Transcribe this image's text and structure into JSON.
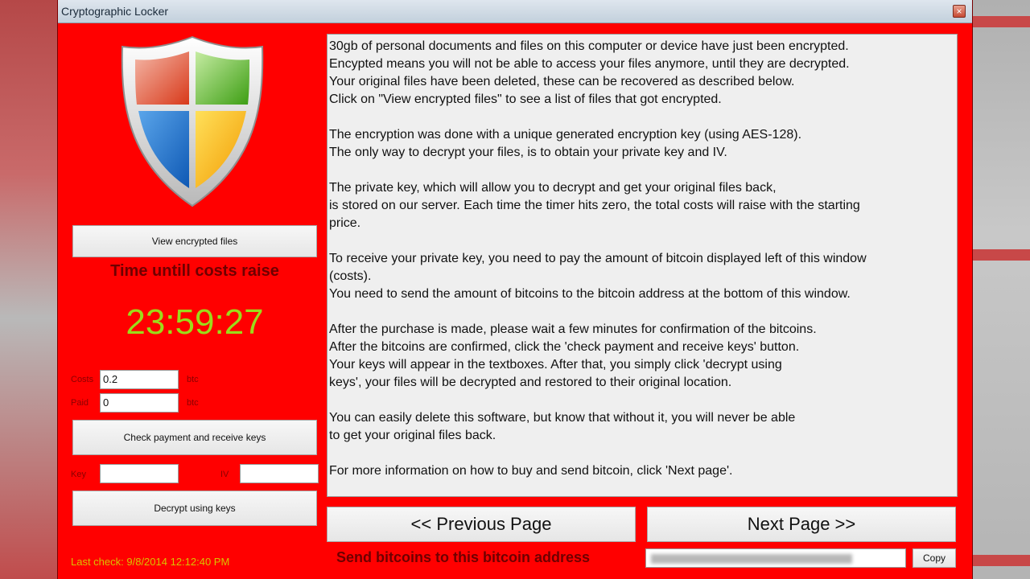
{
  "window": {
    "title": "Cryptographic Locker",
    "close_label": "×",
    "background_color": "#ff0000"
  },
  "left": {
    "view_button": "View encrypted files",
    "time_label": "Time untill costs raise",
    "timer": "23:59:27",
    "costs_label": "Costs",
    "costs_value": "0.2",
    "costs_unit": "btc",
    "paid_label": "Paid",
    "paid_value": "0",
    "paid_unit": "btc",
    "check_button": "Check payment and receive keys",
    "key_label": "Key",
    "key_value": "",
    "iv_label": "IV",
    "iv_value": "",
    "decrypt_button": "Decrypt using keys",
    "last_check": "Last check: 9/8/2014 12:12:40 PM",
    "shield_icon": "windows-shield-icon"
  },
  "message": {
    "paragraphs": [
      [
        "30gb of personal documents and files on this computer or device have just been encrypted.",
        "Encypted means you will not be able to access your files anymore, until they are decrypted.",
        "Your original files have been deleted, these can be recovered as described below.",
        "Click on \"View encrypted files\" to see a list of files that got encrypted."
      ],
      [
        "The encryption was done with a unique generated encryption key (using AES-128).",
        "The only way to decrypt your files, is to obtain your private key and IV."
      ],
      [
        "The private key, which will allow you to decrypt and get your original files back,",
        "is stored on our server. Each time the timer hits zero, the total costs will raise with the starting",
        "price."
      ],
      [
        "To receive your private key, you need to pay the amount of bitcoin displayed left of this window",
        "(costs).",
        "You need to send the amount of bitcoins to the bitcoin address at the bottom of this window."
      ],
      [
        "After the purchase is made, please wait a few minutes for confirmation of the bitcoins.",
        "After the bitcoins are confirmed, click the 'check payment and receive keys' button.",
        "Your keys will appear in the textboxes. After that, you simply click 'decrypt using",
        "keys', your files will be decrypted and restored to their original location."
      ],
      [
        "You can easily delete this software, but know that without it, you will never be able",
        "to get your original files back."
      ],
      [
        "For more information on how to buy and send bitcoin, click 'Next page'."
      ]
    ]
  },
  "bottom": {
    "prev_button": "<< Previous Page",
    "next_button": "Next Page >>",
    "send_label": "Send bitcoins to this bitcoin address",
    "copy_button": "Copy"
  }
}
